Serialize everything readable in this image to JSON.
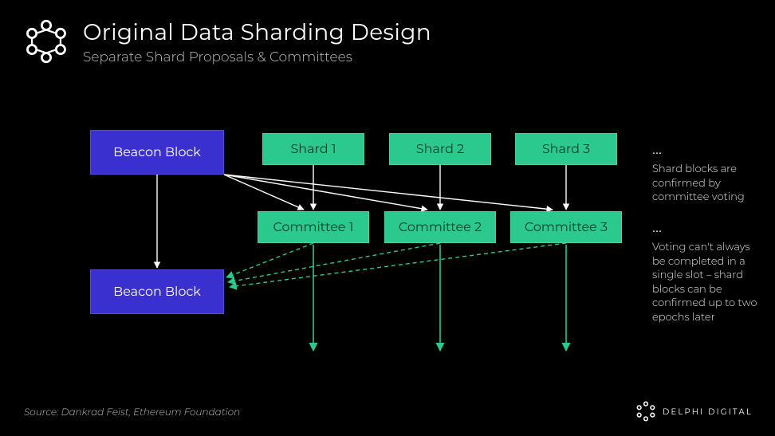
{
  "header": {
    "title": "Original Data Sharding Design",
    "subtitle": "Separate Shard Proposals & Committees"
  },
  "blocks": {
    "beacon1": "Beacon Block",
    "beacon2": "Beacon Block",
    "shard1": "Shard 1",
    "shard2": "Shard 2",
    "shard3": "Shard 3",
    "committee1": "Committee 1",
    "committee2": "Committee 2",
    "committee3": "Committee 3"
  },
  "annotations": {
    "ellipsis_top": "...",
    "ellipsis_mid": "...",
    "note1": "Shard blocks are confirmed by committee voting",
    "note2": "Voting can't always be completed in a single slot – shard blocks can be confirmed up to two epochs later"
  },
  "source": "Source: Dankrad Feist, Ethereum Foundation",
  "brand": "DELPHI DIGITAL",
  "colors": {
    "beacon": "#3930cf",
    "shard": "#2cc98f",
    "arrow_green": "#2cc98f",
    "arrow_white": "#ffffff"
  }
}
